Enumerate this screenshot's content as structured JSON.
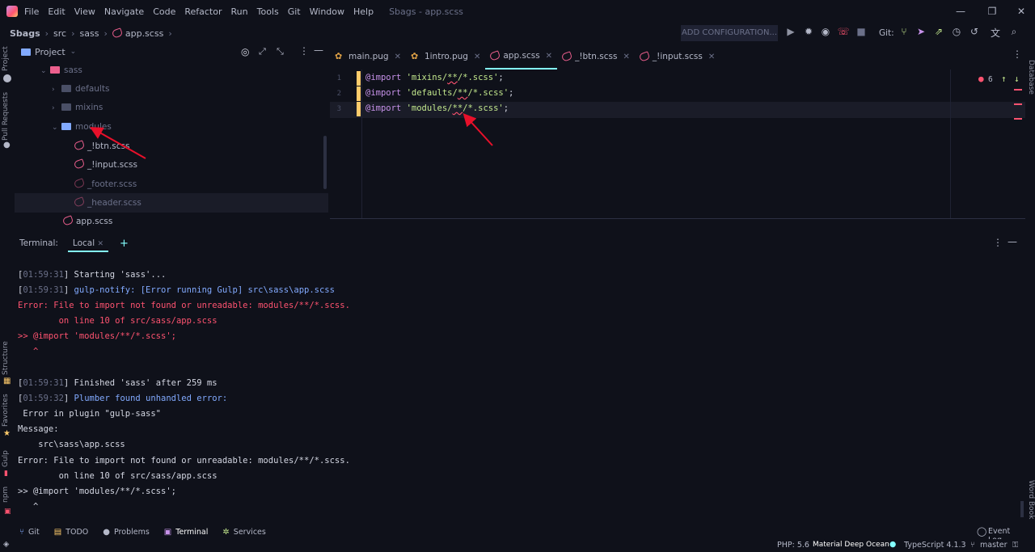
{
  "titlebar": {
    "menu": [
      "File",
      "Edit",
      "View",
      "Navigate",
      "Code",
      "Refactor",
      "Run",
      "Tools",
      "Git",
      "Window",
      "Help"
    ],
    "title": "Sbags - app.scss",
    "minimize": "—",
    "maximize": "❐",
    "close": "✕"
  },
  "navbar": {
    "crumbs": [
      "Sbags",
      "src",
      "sass",
      "app.scss"
    ],
    "add_configuration": "ADD CONFIGURATION...",
    "git_label": "Git:"
  },
  "left_strip": {
    "project": "Project",
    "pull_requests": "Pull Requests",
    "structure": "Structure",
    "favorites": "Favorites",
    "gulp": "Gulp",
    "npm": "npm"
  },
  "right_strip": {
    "database": "Database",
    "word_book": "Word Book"
  },
  "project": {
    "header": "Project",
    "tree": [
      {
        "label": "sass",
        "type": "folder-sass",
        "expanded": true
      },
      {
        "label": "defaults",
        "type": "folder",
        "expanded": false
      },
      {
        "label": "mixins",
        "type": "folder",
        "expanded": false
      },
      {
        "label": "modules",
        "type": "folder",
        "expanded": true
      },
      {
        "label": "_!btn.scss",
        "type": "scss"
      },
      {
        "label": "_!input.scss",
        "type": "scss"
      },
      {
        "label": "_footer.scss",
        "type": "scss-dim"
      },
      {
        "label": "_header.scss",
        "type": "scss-dim"
      },
      {
        "label": "app.scss",
        "type": "scss"
      }
    ]
  },
  "editor": {
    "tabs": [
      {
        "label": "main.pug",
        "icon": "pug",
        "active": false
      },
      {
        "label": "1intro.pug",
        "icon": "pug",
        "active": false
      },
      {
        "label": "app.scss",
        "icon": "sass",
        "active": true
      },
      {
        "label": "_!btn.scss",
        "icon": "sass",
        "active": false
      },
      {
        "label": "_!input.scss",
        "icon": "sass",
        "active": false
      }
    ],
    "line_numbers": [
      "1",
      "2",
      "3"
    ],
    "lines": [
      {
        "kw": "@import",
        "str_pre": "'mixins/",
        "str_err": "**",
        "str_post": "/*.scss'",
        "end": ";"
      },
      {
        "kw": "@import",
        "str_pre": "'defaults/",
        "str_err": "**",
        "str_post": "/*.scss'",
        "end": ";"
      },
      {
        "kw": "@import",
        "str_pre": "'modules/",
        "str_err": "**",
        "str_post": "/*.scss'",
        "end": ";"
      }
    ],
    "error_count": "6"
  },
  "terminal": {
    "title": "Terminal:",
    "tab": "Local",
    "lines": [
      {
        "ts": "01:59:31",
        "text": " Starting 'sass'..."
      },
      {
        "ts": "01:59:31",
        "text": " gulp-notify: [Error running Gulp] src\\sass\\app.scss"
      },
      {
        "text": "Error: File to import not found or unreadable: modules/**/*.scss."
      },
      {
        "text": "        on line 10 of src/sass/app.scss"
      },
      {
        "text": ">> @import 'modules/**/*.scss';"
      },
      {
        "text": "   ^"
      },
      {
        "ts": "01:59:31",
        "text": " Finished 'sass' after 259 ms"
      },
      {
        "ts": "01:59:32",
        "text": " Plumber found unhandled error:"
      },
      {
        "text": " Error in plugin \"gulp-sass\""
      },
      {
        "text": "Message:"
      },
      {
        "text": "    src\\sass\\app.scss"
      },
      {
        "text": "Error: File to import not found or unreadable: modules/**/*.scss."
      },
      {
        "text": "        on line 10 of src/sass/app.scss"
      },
      {
        "text": ">> @import 'modules/**/*.scss';"
      },
      {
        "text": "   ^"
      }
    ]
  },
  "toolwindows": [
    {
      "label": "Git",
      "icon": "git-branch-icon"
    },
    {
      "label": "TODO",
      "icon": "todo-icon"
    },
    {
      "label": "Problems",
      "icon": "problems-icon"
    },
    {
      "label": "Terminal",
      "icon": "terminal-icon"
    },
    {
      "label": "Services",
      "icon": "services-icon"
    }
  ],
  "statusbar": {
    "event_log": "Event Log",
    "php": "PHP: 5.6",
    "theme": "Material Deep Ocean",
    "typescript": "TypeScript 4.1.3",
    "branch": "master"
  },
  "colors": {
    "background": "#0f111a",
    "accent": "#84ffff",
    "error": "#ff5370",
    "keyword": "#c792ea",
    "string": "#c3e88d",
    "sass": "#ec5f8d",
    "annotation_arrow": "#e8102a"
  }
}
